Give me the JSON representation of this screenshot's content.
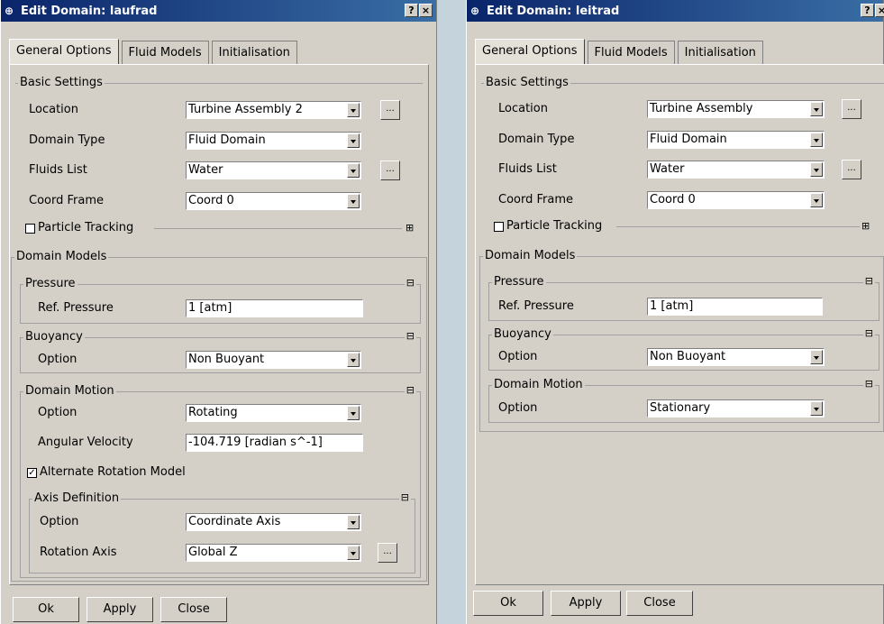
{
  "left": {
    "title": "Edit Domain: laufrad",
    "tabs": [
      "General Options",
      "Fluid Models",
      "Initialisation"
    ],
    "basic": {
      "group_label": "Basic Settings",
      "location_label": "Location",
      "location_value": "Turbine Assembly 2",
      "domain_type_label": "Domain Type",
      "domain_type_value": "Fluid Domain",
      "fluids_label": "Fluids List",
      "fluids_value": "Water",
      "coord_label": "Coord Frame",
      "coord_value": "Coord 0",
      "particle_label": "Particle Tracking"
    },
    "models": {
      "group_label": "Domain Models",
      "pressure_group": "Pressure",
      "ref_pressure_label": "Ref. Pressure",
      "ref_pressure_value": "1 [atm]",
      "buoyancy_group": "Buoyancy",
      "buoyancy_option_label": "Option",
      "buoyancy_option_value": "Non Buoyant",
      "motion_group": "Domain Motion",
      "motion_option_label": "Option",
      "motion_option_value": "Rotating",
      "angular_label": "Angular Velocity",
      "angular_value": "-104.719 [radian s^-1]",
      "alt_rotation_label": "Alternate Rotation Model",
      "axis_group": "Axis Definition",
      "axis_option_label": "Option",
      "axis_option_value": "Coordinate Axis",
      "rotation_axis_label": "Rotation Axis",
      "rotation_axis_value": "Global Z"
    },
    "buttons": {
      "ok": "Ok",
      "apply": "Apply",
      "close": "Close"
    }
  },
  "right": {
    "title": "Edit Domain: leitrad",
    "tabs": [
      "General Options",
      "Fluid Models",
      "Initialisation"
    ],
    "basic": {
      "group_label": "Basic Settings",
      "location_label": "Location",
      "location_value": "Turbine Assembly",
      "domain_type_label": "Domain Type",
      "domain_type_value": "Fluid Domain",
      "fluids_label": "Fluids List",
      "fluids_value": "Water",
      "coord_label": "Coord Frame",
      "coord_value": "Coord 0",
      "particle_label": "Particle Tracking"
    },
    "models": {
      "group_label": "Domain Models",
      "pressure_group": "Pressure",
      "ref_pressure_label": "Ref. Pressure",
      "ref_pressure_value": "1 [atm]",
      "buoyancy_group": "Buoyancy",
      "buoyancy_option_label": "Option",
      "buoyancy_option_value": "Non Buoyant",
      "motion_group": "Domain Motion",
      "motion_option_label": "Option",
      "motion_option_value": "Stationary"
    },
    "buttons": {
      "ok": "Ok",
      "apply": "Apply",
      "close": "Close"
    }
  },
  "common": {
    "help_glyph": "?",
    "close_glyph": "×",
    "browse_glyph": "...",
    "checked_glyph": "✓",
    "minus_glyph": "⊟",
    "plus_glyph": "⊞",
    "window_icon": "⊕"
  }
}
